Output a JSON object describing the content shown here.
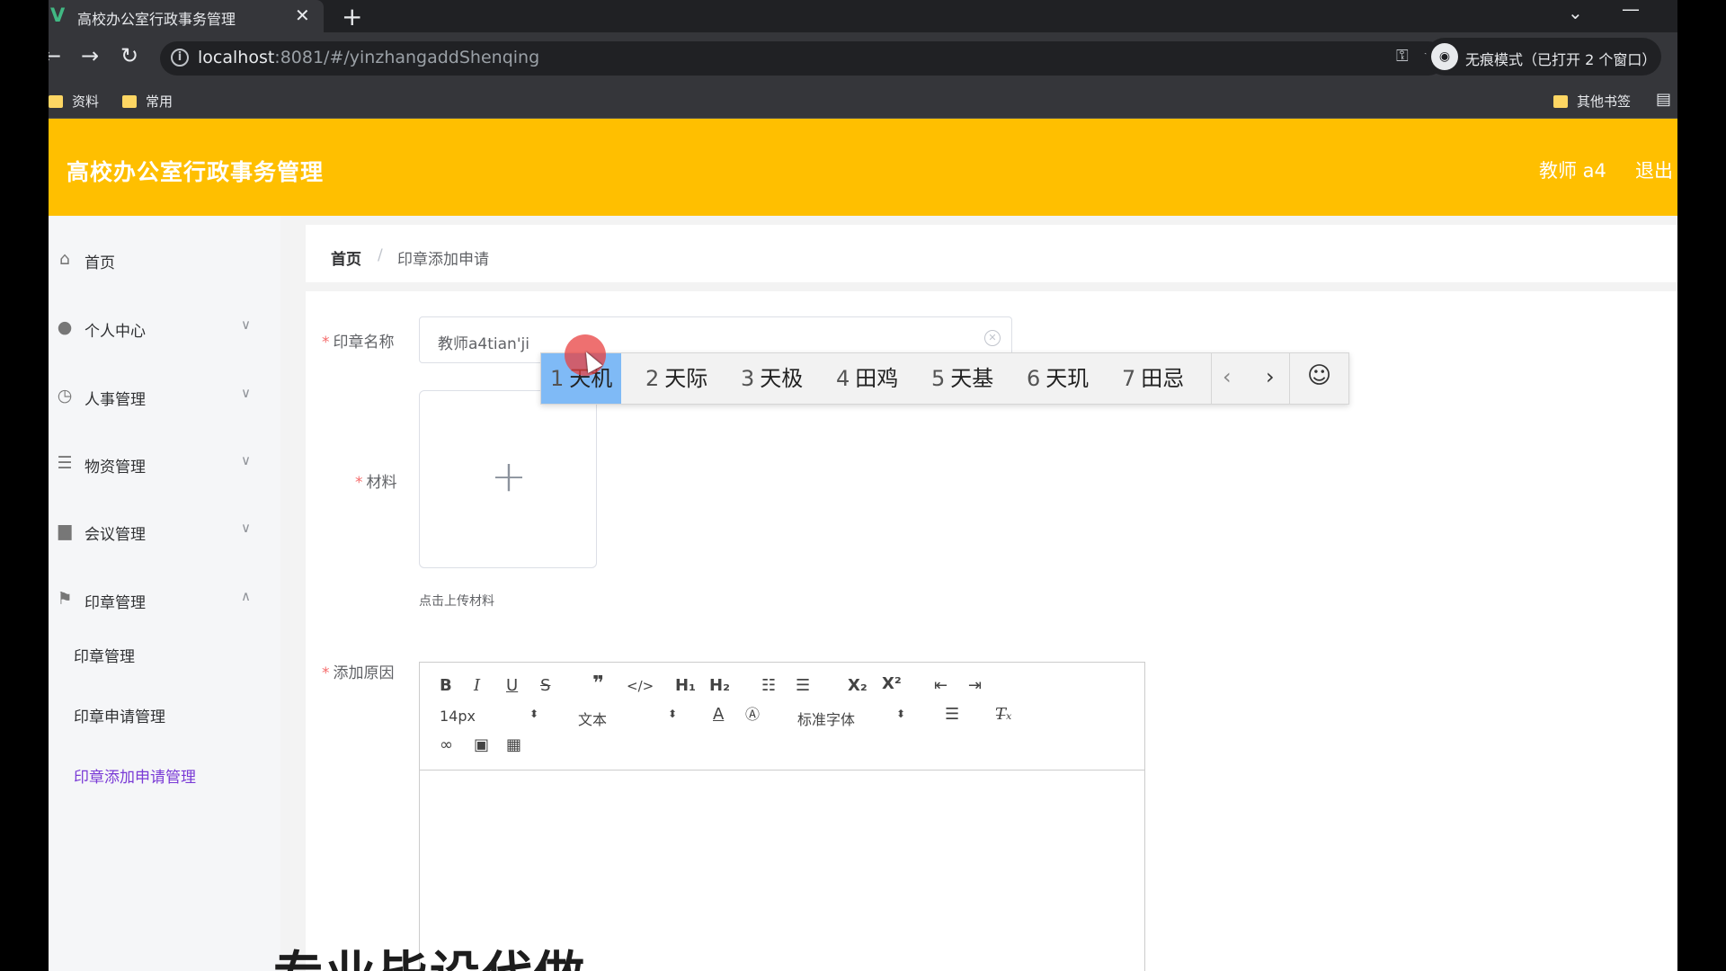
{
  "browser": {
    "tab_title": "高校办公室行政事务管理",
    "tab_close": "✕",
    "new_tab": "+",
    "url_host": "localhost",
    "url_rest": ":8081/#/yinzhangaddShenqing",
    "incognito_label": "无痕模式（已打开 2 个窗口）",
    "bookmarks": [
      "资料",
      "常用"
    ],
    "other_bookmarks": "其他书签"
  },
  "header": {
    "title": "高校办公室行政事务管理",
    "user": "教师 a4",
    "logout": "退出"
  },
  "sidebar": {
    "items": [
      {
        "label": "首页",
        "icon": "home-icon"
      },
      {
        "label": "个人中心",
        "icon": "user-icon"
      },
      {
        "label": "人事管理",
        "icon": "clock-icon"
      },
      {
        "label": "物资管理",
        "icon": "list-icon"
      },
      {
        "label": "会议管理",
        "icon": "chat-icon"
      },
      {
        "label": "印章管理",
        "icon": "flag-icon"
      }
    ],
    "sub_items": [
      "印章管理",
      "印章申请管理",
      "印章添加申请管理"
    ]
  },
  "breadcrumb": {
    "home": "首页",
    "separator": "/",
    "current": "印章添加申请"
  },
  "form": {
    "name_label": "印章名称",
    "name_value": "教师a4tian'ji",
    "material_label": "材料",
    "upload_tip": "点击上传材料",
    "reason_label": "添加原因",
    "editor": {
      "font_size": "14px",
      "block_type": "文本",
      "font_family": "标准字体"
    }
  },
  "ime": {
    "candidates": [
      {
        "n": "1",
        "text": "天机"
      },
      {
        "n": "2",
        "text": "天际"
      },
      {
        "n": "3",
        "text": "天极"
      },
      {
        "n": "4",
        "text": "田鸡"
      },
      {
        "n": "5",
        "text": "天基"
      },
      {
        "n": "6",
        "text": "天玑"
      },
      {
        "n": "7",
        "text": "田忌"
      }
    ]
  },
  "watermark": "专业毕设代做",
  "colors": {
    "header": "#ffbf00",
    "active_submenu": "#7a3bd6",
    "ime_selected": "#7fbaf6"
  }
}
